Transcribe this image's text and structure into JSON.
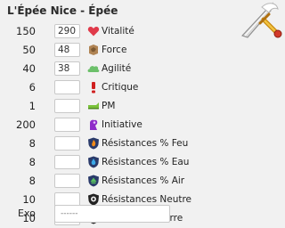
{
  "item": {
    "title": "L'Épée Nice - Épée"
  },
  "stats": [
    {
      "value": "150",
      "input": "290",
      "label": "Vitalité",
      "icon": "heart-icon"
    },
    {
      "value": "50",
      "input": "48",
      "label": "Force",
      "icon": "earth-icon"
    },
    {
      "value": "40",
      "input": "38",
      "label": "Agilité",
      "icon": "cloud-icon"
    },
    {
      "value": "6",
      "input": "",
      "label": "Critique",
      "icon": "critical-icon"
    },
    {
      "value": "1",
      "input": "",
      "label": "PM",
      "icon": "boot-icon"
    },
    {
      "value": "200",
      "input": "",
      "label": "Initiative",
      "icon": "initiative-icon"
    },
    {
      "value": "8",
      "input": "",
      "label": "Résistances % Feu",
      "icon": "fire-shield-icon"
    },
    {
      "value": "8",
      "input": "",
      "label": "Résistances % Eau",
      "icon": "water-shield-icon"
    },
    {
      "value": "8",
      "input": "",
      "label": "Résistances % Air",
      "icon": "air-shield-icon"
    },
    {
      "value": "10",
      "input": "",
      "label": "Résistances Neutre",
      "icon": "neutral-shield-icon"
    },
    {
      "value": "10",
      "input": "",
      "label": "Résistances Terre",
      "icon": "earth-shield-icon"
    }
  ],
  "exo": {
    "label": "Exo",
    "value": "------"
  },
  "colors": {
    "background": "#f1f1f1",
    "input_border": "#c9c9c9"
  }
}
